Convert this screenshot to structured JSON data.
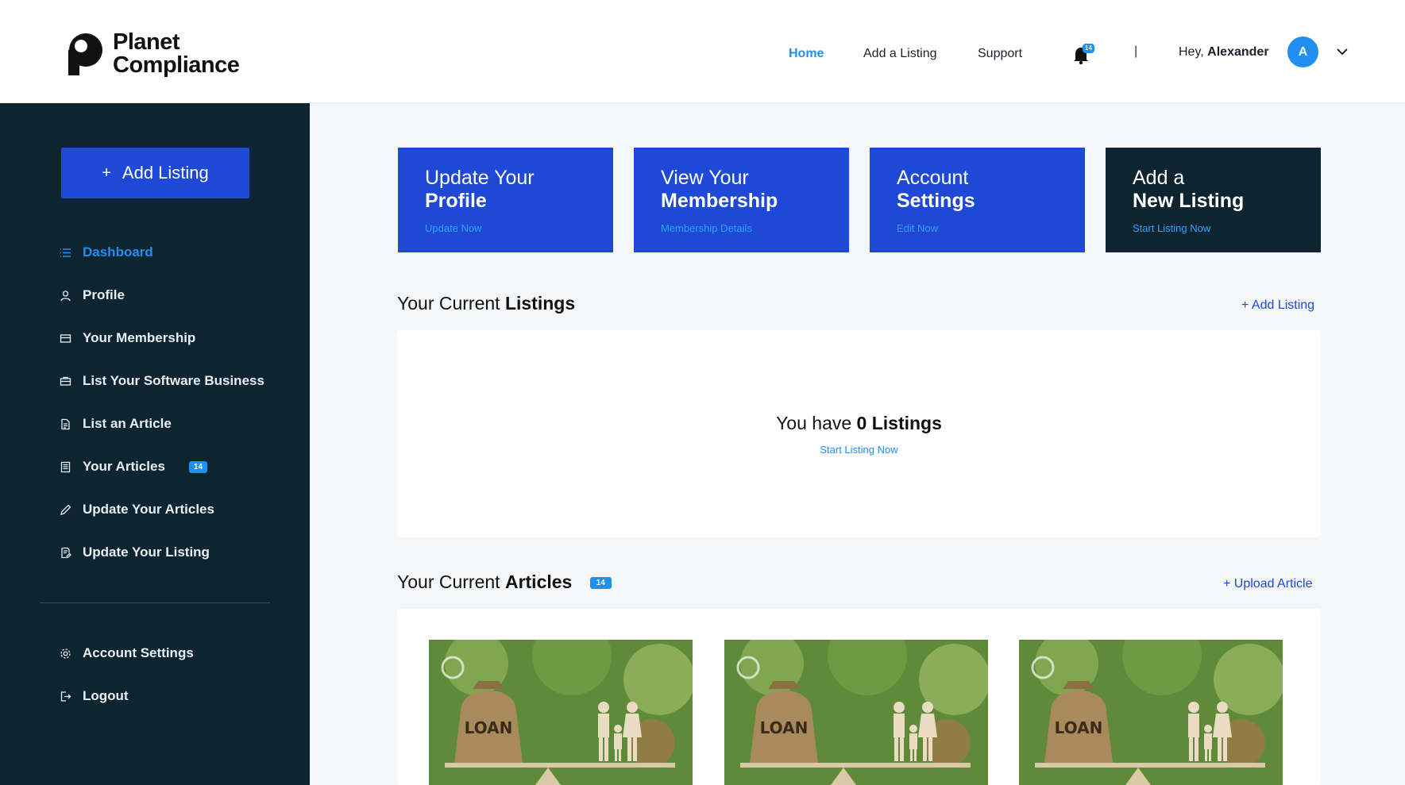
{
  "header": {
    "logo_line1": "Planet",
    "logo_line2": "Compliance",
    "nav": [
      {
        "label": "Home",
        "active": true
      },
      {
        "label": "Add a Listing",
        "active": false
      },
      {
        "label": "Support",
        "active": false
      }
    ],
    "notification_count": "14",
    "separator": "|",
    "greeting": "Hey,",
    "user_name": "Alexander",
    "avatar_initial": "A"
  },
  "sidebar": {
    "add_button": "Add Listing",
    "items": [
      {
        "label": "Dashboard",
        "icon": "list-icon",
        "active": true
      },
      {
        "label": "Profile",
        "icon": "user-icon"
      },
      {
        "label": "Your Membership",
        "icon": "card-icon"
      },
      {
        "label": "List Your Software Business",
        "icon": "briefcase-icon"
      },
      {
        "label": "List an Article",
        "icon": "document-icon"
      },
      {
        "label": "Your Articles",
        "icon": "articles-icon",
        "badge": "14"
      },
      {
        "label": "Update Your Articles",
        "icon": "pencil-icon"
      },
      {
        "label": "Update Your Listing",
        "icon": "edit-document-icon"
      }
    ],
    "bottom_items": [
      {
        "label": "Account Settings",
        "icon": "gear-icon"
      },
      {
        "label": "Logout",
        "icon": "logout-icon"
      }
    ]
  },
  "cards": [
    {
      "line1": "Update Your",
      "line2": "Profile",
      "sub": "Update Now"
    },
    {
      "line1": "View Your",
      "line2": "Membership",
      "sub": "Membership Details"
    },
    {
      "line1": "Account",
      "line2": "Settings",
      "sub": "Edit Now"
    },
    {
      "line1": "Add a",
      "line2": "New Listing",
      "sub": "Start Listing Now"
    }
  ],
  "listings": {
    "title_prefix": "Your Current",
    "title_bold": "Listings",
    "add_link": "+ Add Listing",
    "empty_prefix": "You have",
    "empty_bold": "0 Listings",
    "empty_link": "Start Listing Now"
  },
  "articles": {
    "title_prefix": "Your Current",
    "title_bold": "Articles",
    "badge": "14",
    "upload_link": "+ Upload Article",
    "thumbnails": [
      {
        "caption": "LOAN"
      },
      {
        "caption": "LOAN"
      },
      {
        "caption": "LOAN"
      }
    ]
  },
  "colors": {
    "primary_blue": "#1e48d6",
    "accent_blue": "#1f8ff0",
    "sidebar_dark": "#0d2530",
    "background": "#f5f6f8"
  }
}
